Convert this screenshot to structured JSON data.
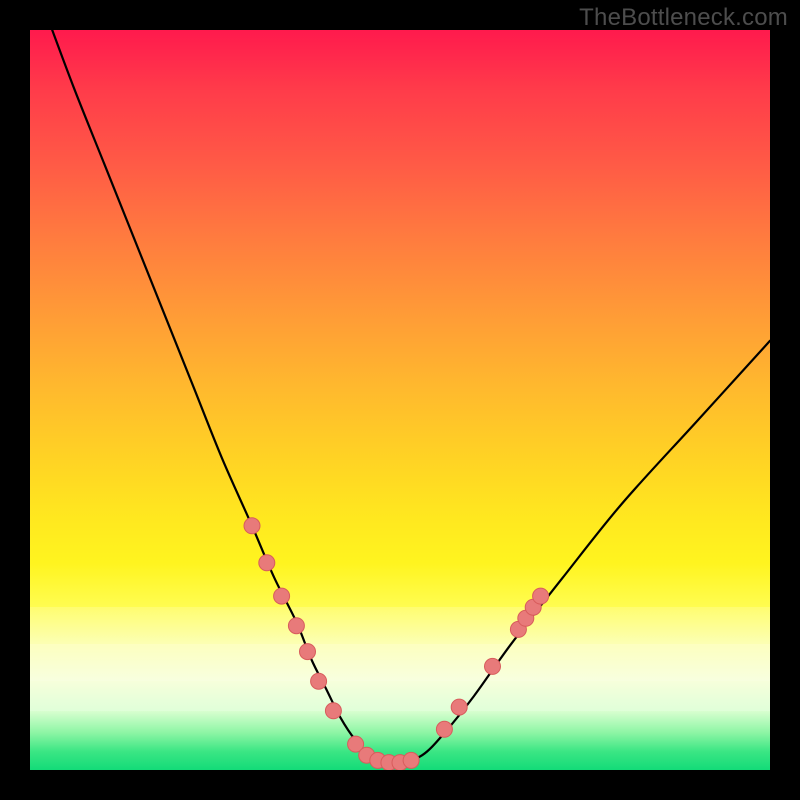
{
  "watermark": "TheBottleneck.com",
  "colors": {
    "curve_stroke": "#000000",
    "dot_fill": "#e87a7a",
    "dot_stroke": "#d85c5c",
    "frame": "#000000"
  },
  "chart_data": {
    "type": "line",
    "title": "",
    "xlabel": "",
    "ylabel": "",
    "xlim": [
      0,
      100
    ],
    "ylim": [
      0,
      100
    ],
    "grid": false,
    "legend": false,
    "series": [
      {
        "name": "bottleneck-curve",
        "x": [
          3,
          6,
          10,
          14,
          18,
          22,
          26,
          30,
          33,
          36,
          38,
          40,
          42,
          44,
          46,
          48,
          50,
          53,
          56,
          60,
          65,
          72,
          80,
          90,
          100
        ],
        "y": [
          100,
          92,
          82,
          72,
          62,
          52,
          42,
          33,
          26,
          20,
          15,
          11,
          7,
          4,
          2,
          1,
          1,
          2,
          5,
          10,
          17,
          26,
          36,
          47,
          58
        ]
      }
    ],
    "markers": [
      {
        "x": 30.0,
        "y": 33.0
      },
      {
        "x": 32.0,
        "y": 28.0
      },
      {
        "x": 34.0,
        "y": 23.5
      },
      {
        "x": 36.0,
        "y": 19.5
      },
      {
        "x": 37.5,
        "y": 16.0
      },
      {
        "x": 39.0,
        "y": 12.0
      },
      {
        "x": 41.0,
        "y": 8.0
      },
      {
        "x": 44.0,
        "y": 3.5
      },
      {
        "x": 45.5,
        "y": 2.0
      },
      {
        "x": 47.0,
        "y": 1.3
      },
      {
        "x": 48.5,
        "y": 1.0
      },
      {
        "x": 50.0,
        "y": 1.0
      },
      {
        "x": 51.5,
        "y": 1.3
      },
      {
        "x": 56.0,
        "y": 5.5
      },
      {
        "x": 58.0,
        "y": 8.5
      },
      {
        "x": 62.5,
        "y": 14.0
      },
      {
        "x": 66.0,
        "y": 19.0
      },
      {
        "x": 67.0,
        "y": 20.5
      },
      {
        "x": 68.0,
        "y": 22.0
      },
      {
        "x": 69.0,
        "y": 23.5
      }
    ],
    "marker_radius": 8
  }
}
